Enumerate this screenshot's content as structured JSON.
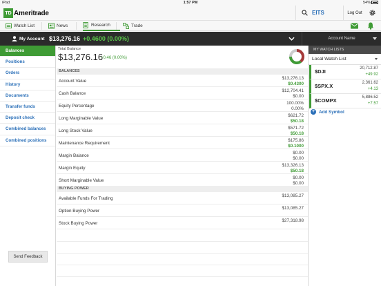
{
  "status_bar": {
    "device": "iPad",
    "time": "1:57 PM",
    "battery": "54%"
  },
  "header": {
    "logo_box": "TD",
    "logo_text": "Ameritrade",
    "search_symbol": "EITS",
    "logout_label": "Log Out"
  },
  "tabs": [
    {
      "label": "Watch List",
      "icon": "watchlist-icon"
    },
    {
      "label": "News",
      "icon": "news-icon"
    },
    {
      "label": "Research",
      "icon": "research-icon",
      "active": true
    },
    {
      "label": "Trade",
      "icon": "trade-icon"
    }
  ],
  "account_bar": {
    "my_account_label": "My Account",
    "value": "$13,276.16",
    "change": "+0.4600 (0.00%)",
    "account_name_label": "Account Name"
  },
  "left_nav": {
    "items": [
      {
        "label": "Balances",
        "active": true
      },
      {
        "label": "Positions"
      },
      {
        "label": "Orders"
      },
      {
        "label": "History"
      },
      {
        "label": "Documents"
      },
      {
        "label": "Transfer funds"
      },
      {
        "label": "Deposit check"
      },
      {
        "label": "Combined balances"
      },
      {
        "label": "Combined positions"
      }
    ],
    "feedback_label": "Send Feedback"
  },
  "main": {
    "total_balance_label": "Total Balance",
    "total_balance_value": "$13,276.16",
    "total_balance_change": "+0.46",
    "total_balance_pct": "(0.00%)",
    "balances_header": "BALANCES",
    "balances": [
      {
        "label": "Account Value",
        "v1": "$13,276.13",
        "v2": "$0.4300"
      },
      {
        "label": "Cash Balance",
        "v1": "$12,704.41",
        "v2": "$0.00",
        "v2_plain": true
      },
      {
        "label": "Equity Percentage",
        "v1": "100.00%",
        "v2": "0.00%",
        "v2_plain": true
      },
      {
        "label": "Long Marginable Value",
        "v1": "$621.72",
        "v2": "$50.18"
      },
      {
        "label": "Long Stock Value",
        "v1": "$571.72",
        "v2": "$50.18"
      },
      {
        "label": "Maintenance Requirement",
        "v1": "$175.86",
        "v2": "$0.1000"
      },
      {
        "label": "Margin Balance",
        "v1": "$0.00",
        "v2": "$0.00",
        "v2_plain": true
      },
      {
        "label": "Margin Equity",
        "v1": "$13,326.13",
        "v2": "$50.18"
      },
      {
        "label": "Short Marginable Value",
        "v1": "$0.00",
        "v2": "$0.00",
        "v2_plain": true
      }
    ],
    "buying_power_header": "BUYING POWER",
    "buying_power": [
      {
        "label": "Available Funds For Trading",
        "v1": "$13,085.27"
      },
      {
        "label": "Option Buying Power",
        "v1": "$13,085.27"
      },
      {
        "label": "Stock Buying Power",
        "v1": "$27,318.98"
      }
    ],
    "donut_colors": [
      "#3f9b35",
      "#a63a3a",
      "#cccccc"
    ]
  },
  "watchlist": {
    "header": "MY WATCH LISTS",
    "selected_list": "Local Watch List",
    "items": [
      {
        "symbol": "$DJI",
        "price": "20,712.87",
        "change": "+49.92"
      },
      {
        "symbol": "$SPX.X",
        "price": "2,361.62",
        "change": "+4.13"
      },
      {
        "symbol": "$COMPX",
        "price": "5,886.52",
        "change": "+7.57"
      }
    ],
    "add_symbol_label": "Add Symbol"
  },
  "colors": {
    "brand_green": "#3f9b35",
    "link_blue": "#2a6fb8",
    "dark_bar": "#2b2b2b"
  }
}
